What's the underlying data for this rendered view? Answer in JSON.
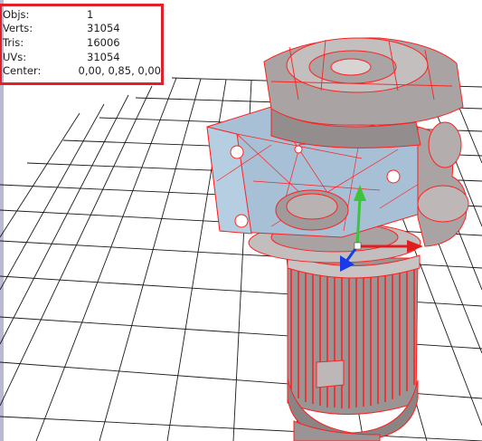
{
  "viewport": {
    "stats": [
      {
        "label": "Objs:",
        "value": "1"
      },
      {
        "label": "Verts:",
        "value": "31054"
      },
      {
        "label": "Tris:",
        "value": "16006"
      },
      {
        "label": "UVs:",
        "value": "31054"
      },
      {
        "label": "Center:",
        "value": "0,00, 0,85, 0,00"
      }
    ],
    "gizmo_colors": {
      "x": "#e01e1e",
      "y": "#3cc43c",
      "z": "#1a3ae8"
    },
    "highlight_color": "#e0202a",
    "wireframe_color": "#ff2020"
  }
}
